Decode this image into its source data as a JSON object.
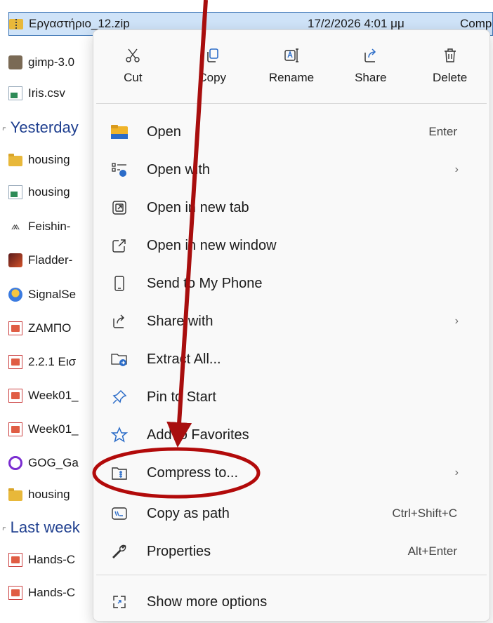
{
  "file_list": {
    "rows": [
      {
        "id": "r0",
        "icon": "zip-folder-icon",
        "name": "Εργαστήριο_12.zip",
        "date": "17/2/2026 4:01 μμ",
        "type": "Comp",
        "selected": true
      },
      {
        "id": "r1",
        "icon": "gimp-icon",
        "name": "gimp-3.0",
        "edge": "ic"
      },
      {
        "id": "r2",
        "icon": "csv-file-icon",
        "name": "Iris.csv",
        "edge": "o"
      }
    ],
    "groups": [
      {
        "label": "Yesterday",
        "items": [
          {
            "icon": "folder-icon",
            "name": "housing",
            "edge": "p"
          },
          {
            "icon": "csv-file-icon",
            "name": "housing",
            "edge": "o"
          },
          {
            "icon": "feishin-icon",
            "name": "Feishin-",
            "edge": "ic"
          },
          {
            "icon": "fladder-icon",
            "name": "Fladder-",
            "edge": "ic"
          },
          {
            "icon": "signal-icon",
            "name": "SignalSe",
            "edge": "ic"
          },
          {
            "icon": "pdf-file-icon",
            "name": "ΖΑΜΠΟ",
            "edge": "F"
          },
          {
            "icon": "pdf-file-icon",
            "name": "2.2.1 Εισ",
            "edge": "F"
          },
          {
            "icon": "pdf-file-icon",
            "name": "Week01_",
            "edge": "F"
          },
          {
            "icon": "pdf-file-icon",
            "name": "Week01_",
            "edge": "F"
          },
          {
            "icon": "gog-icon",
            "name": "GOG_Ga",
            "edge": "ic"
          },
          {
            "icon": "folder-icon",
            "name": "housing",
            "edge": "o"
          }
        ]
      },
      {
        "label": "Last week",
        "items": [
          {
            "icon": "pdf-file-icon",
            "name": "Hands-C",
            "edge": "F"
          },
          {
            "icon": "pdf-file-icon",
            "name": "Hands-C",
            "edge": "F"
          }
        ]
      }
    ]
  },
  "context_menu": {
    "quick_actions": [
      {
        "label": "Cut",
        "icon": "scissors-icon"
      },
      {
        "label": "Copy",
        "icon": "copy-icon"
      },
      {
        "label": "Rename",
        "icon": "rename-icon"
      },
      {
        "label": "Share",
        "icon": "share-icon"
      },
      {
        "label": "Delete",
        "icon": "trash-icon"
      }
    ],
    "items": [
      {
        "label": "Open",
        "icon": "folder-open-icon",
        "shortcut": "Enter"
      },
      {
        "label": "Open with",
        "icon": "open-with-icon",
        "submenu": true
      },
      {
        "label": "Open in new tab",
        "icon": "new-tab-icon"
      },
      {
        "label": "Open in new window",
        "icon": "new-window-icon"
      },
      {
        "label": "Send to My Phone",
        "icon": "phone-icon"
      },
      {
        "label": "Share with",
        "icon": "share-with-icon",
        "submenu": true
      },
      {
        "label": "Extract All...",
        "icon": "extract-icon"
      },
      {
        "label": "Pin to Start",
        "icon": "pin-icon"
      },
      {
        "label": "Add to Favorites",
        "icon": "star-icon"
      },
      {
        "label": "Compress to...",
        "icon": "compress-icon",
        "submenu": true,
        "highlighted": true
      },
      {
        "label": "Copy as path",
        "icon": "copy-path-icon",
        "shortcut": "Ctrl+Shift+C"
      },
      {
        "label": "Properties",
        "icon": "wrench-icon",
        "shortcut": "Alt+Enter"
      },
      {
        "label": "Show more options",
        "icon": "more-options-icon"
      }
    ]
  },
  "annotation": {
    "arrow_color": "#a80e0e",
    "ellipse_color": "#b20a0a",
    "target": "Compress to..."
  },
  "colors": {
    "selection_bg": "#cfe3f8",
    "selection_border": "#3b74b5",
    "group_header": "#1f3f8f",
    "menu_bg": "#f9f9f9"
  }
}
